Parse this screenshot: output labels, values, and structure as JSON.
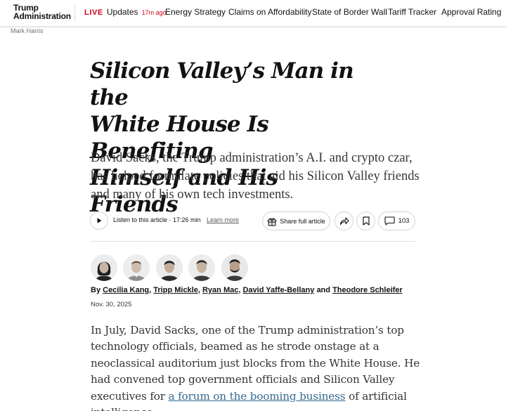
{
  "topbar": {
    "section_line1": "Trump",
    "section_line2": "Administration",
    "live_tag": "LIVE",
    "live_label": "Updates",
    "live_time": "17m ago",
    "nav_items": [
      "Energy Strategy",
      "Claims on Affordability",
      "State of Border Wall",
      "Tariff Tracker",
      "Approval Rating"
    ]
  },
  "photo_credit": "Mark Harris",
  "article": {
    "headline_lines": [
      "Silicon Valley’s Man in the",
      "White House Is Benefiting",
      "Himself and His Friends"
    ],
    "summary": "David Sacks, the Trump administration’s A.I. and crypto czar, has helped formulate policies that aid his Silicon Valley friends and many of his own tech investments.",
    "toolbar": {
      "listen": "Listen to this article · 17:26 min",
      "learn_more": "Learn more",
      "share": "Share full article",
      "comments_count": "103"
    },
    "byline": {
      "prefix": "By",
      "authors": [
        "Cecilia Kang",
        "Tripp Mickle",
        "Ryan Mac",
        "David Yaffe-Bellany",
        "Theodore Schleifer"
      ],
      "sep": ",",
      "and": "and"
    },
    "date": "Nov. 30, 2025",
    "body_before_link": "In July, David Sacks, one of the Trump administration’s top technology officials, beamed as he strode onstage at a neoclassical auditorium just blocks from the White House. He had convened top government officials and Silicon Valley executives for ",
    "body_link": "a forum on the booming business",
    "body_after_link": " of artificial intelligence."
  },
  "colors": {
    "live_red": "#d0021b",
    "link_blue": "#326891",
    "text": "#121212"
  }
}
